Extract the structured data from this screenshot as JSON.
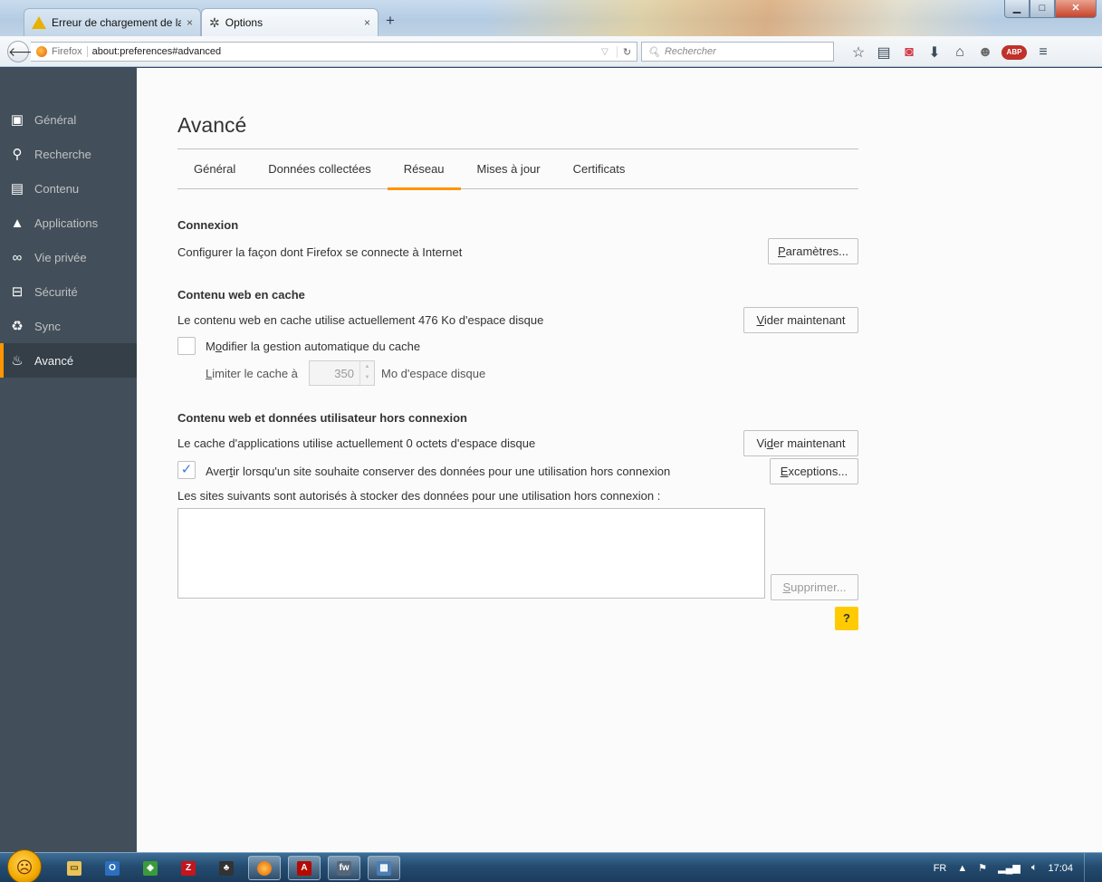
{
  "browser": {
    "tabs": [
      {
        "label": "Erreur de chargement de la...",
        "icon": "warning-icon",
        "close": "×"
      },
      {
        "label": "Options",
        "icon": "gear-icon",
        "close": "×"
      }
    ],
    "new_tab": "+",
    "identity": "Firefox",
    "url": "about:preferences#advanced",
    "search_placeholder": "Rechercher",
    "toolbar_icons": [
      "bookmark-star-icon",
      "reading-list-icon",
      "pocket-icon",
      "download-icon",
      "home-icon",
      "smiley-icon",
      "adblock-plus-icon",
      "menu-icon"
    ],
    "abp_label": "ABP"
  },
  "sidebar": {
    "items": [
      {
        "label": "Général",
        "icon": "general-icon"
      },
      {
        "label": "Recherche",
        "icon": "search-icon"
      },
      {
        "label": "Contenu",
        "icon": "content-icon"
      },
      {
        "label": "Applications",
        "icon": "applications-icon"
      },
      {
        "label": "Vie privée",
        "icon": "privacy-mask-icon"
      },
      {
        "label": "Sécurité",
        "icon": "security-lock-icon"
      },
      {
        "label": "Sync",
        "icon": "sync-icon"
      },
      {
        "label": "Avancé",
        "icon": "advanced-icon",
        "active": true
      }
    ]
  },
  "main": {
    "title": "Avancé",
    "tabs": [
      {
        "label": "Général"
      },
      {
        "label": "Données collectées"
      },
      {
        "label": "Réseau",
        "selected": true
      },
      {
        "label": "Mises à jour"
      },
      {
        "label": "Certificats"
      }
    ],
    "connexion": {
      "heading": "Connexion",
      "desc": "Configurer la façon dont Firefox se connecte à Internet",
      "button_prefix": "",
      "button_key": "P",
      "button_rest": "aramètres..."
    },
    "cache": {
      "heading": "Contenu web en cache",
      "desc": "Le contenu web en cache utilise actuellement 476 Ko d'espace disque",
      "button_prefix": "",
      "button_key": "V",
      "button_rest": "ider maintenant",
      "override_key": "o",
      "override_pre": "M",
      "override_post": "difier la gestion automatique du cache",
      "override_checked": false,
      "limit_key": "L",
      "limit_rest": "imiter le cache à",
      "limit_value": "350",
      "limit_unit": "Mo d'espace disque"
    },
    "offline": {
      "heading": "Contenu web et données utilisateur hors connexion",
      "desc": "Le cache d'applications utilise actuellement 0 octets d'espace disque",
      "button_prefix": "Vi",
      "button_key": "d",
      "button_rest": "er maintenant",
      "warn_pre": "Aver",
      "warn_key": "t",
      "warn_post": "ir lorsqu'un site souhaite conserver des données pour une utilisation hors connexion",
      "warn_checked": true,
      "exceptions_key": "E",
      "exceptions_rest": "xceptions...",
      "list_label": "Les sites suivants sont autorisés à stocker des données pour une utilisation hors connexion :",
      "remove_key": "S",
      "remove_rest": "upprimer..."
    },
    "help": "?"
  },
  "taskbar": {
    "lang": "FR",
    "time": "17:04",
    "apps": [
      "explorer-icon",
      "outlook-icon",
      "app-icon",
      "filezilla-icon",
      "inkscape-icon",
      "firefox-icon",
      "acrobat-icon",
      "fireworks-icon",
      "app2-icon"
    ]
  }
}
